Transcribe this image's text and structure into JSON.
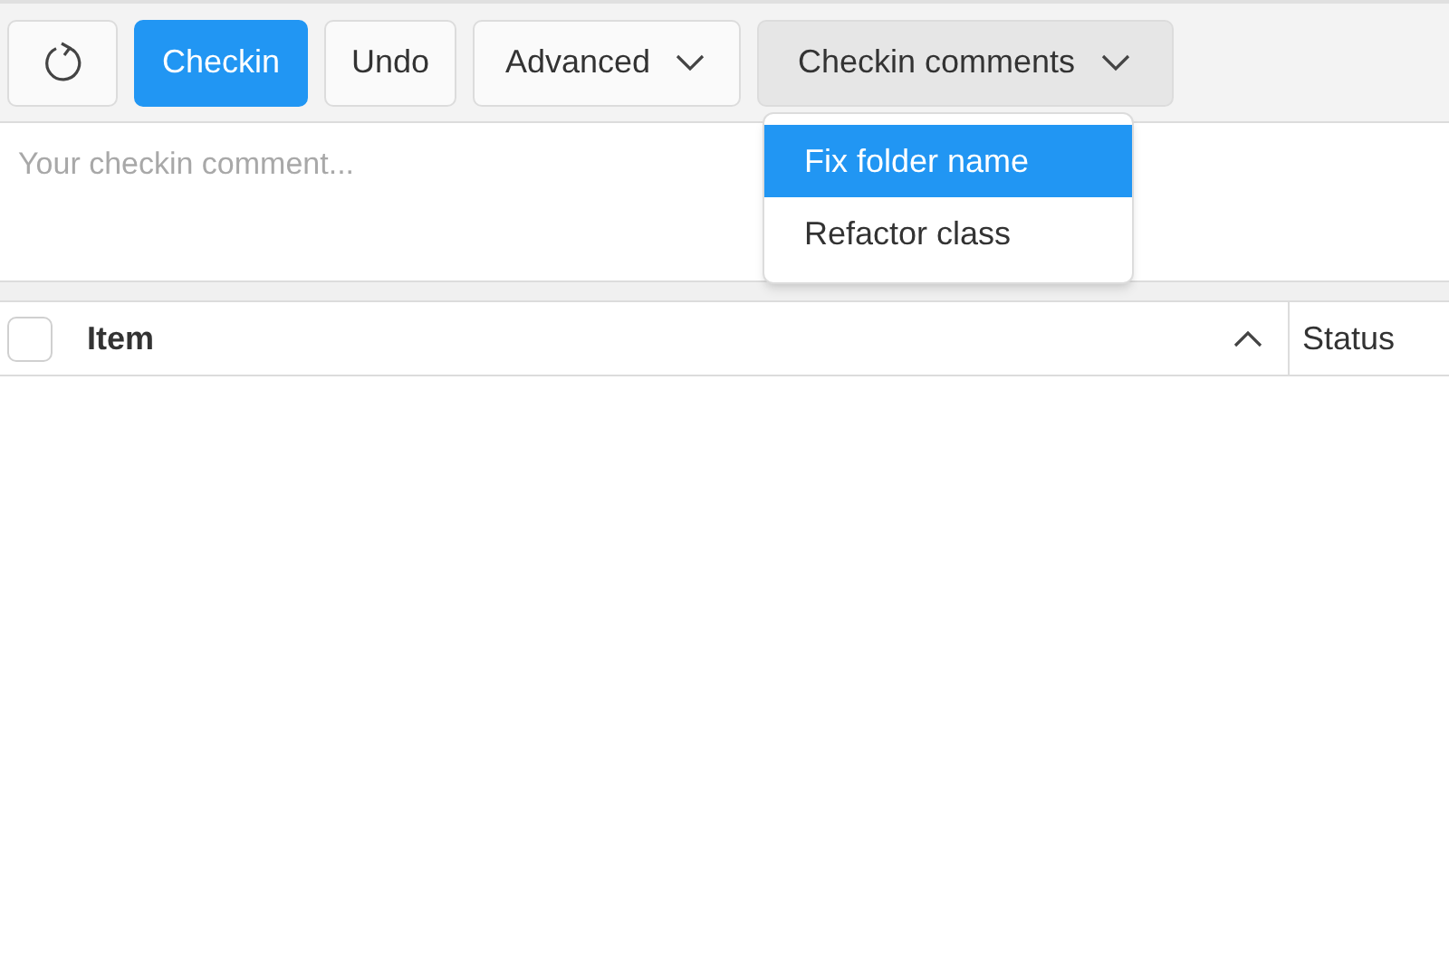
{
  "toolbar": [
    {
      "kind": "icon",
      "primary": false,
      "pressed": false
    },
    {
      "kind": "text",
      "label": "Checkin",
      "primary": true,
      "pressed": false
    },
    {
      "kind": "text",
      "label": "Undo",
      "primary": false,
      "pressed": false
    },
    {
      "kind": "menu",
      "label": "Advanced",
      "primary": false,
      "pressed": false
    },
    {
      "kind": "menu",
      "label": "Checkin comments",
      "primary": false,
      "pressed": true
    }
  ],
  "comment": {
    "placeholder": "Your checkin comment..."
  },
  "dropdown": [
    {
      "label": "Fix folder name",
      "selected": true
    },
    {
      "label": "Refactor class",
      "selected": false
    }
  ],
  "table": {
    "select_all": {
      "checked": false
    },
    "columns": [
      {
        "label": "Item",
        "sorted_ascending": true
      },
      {
        "label": "Status"
      }
    ]
  }
}
